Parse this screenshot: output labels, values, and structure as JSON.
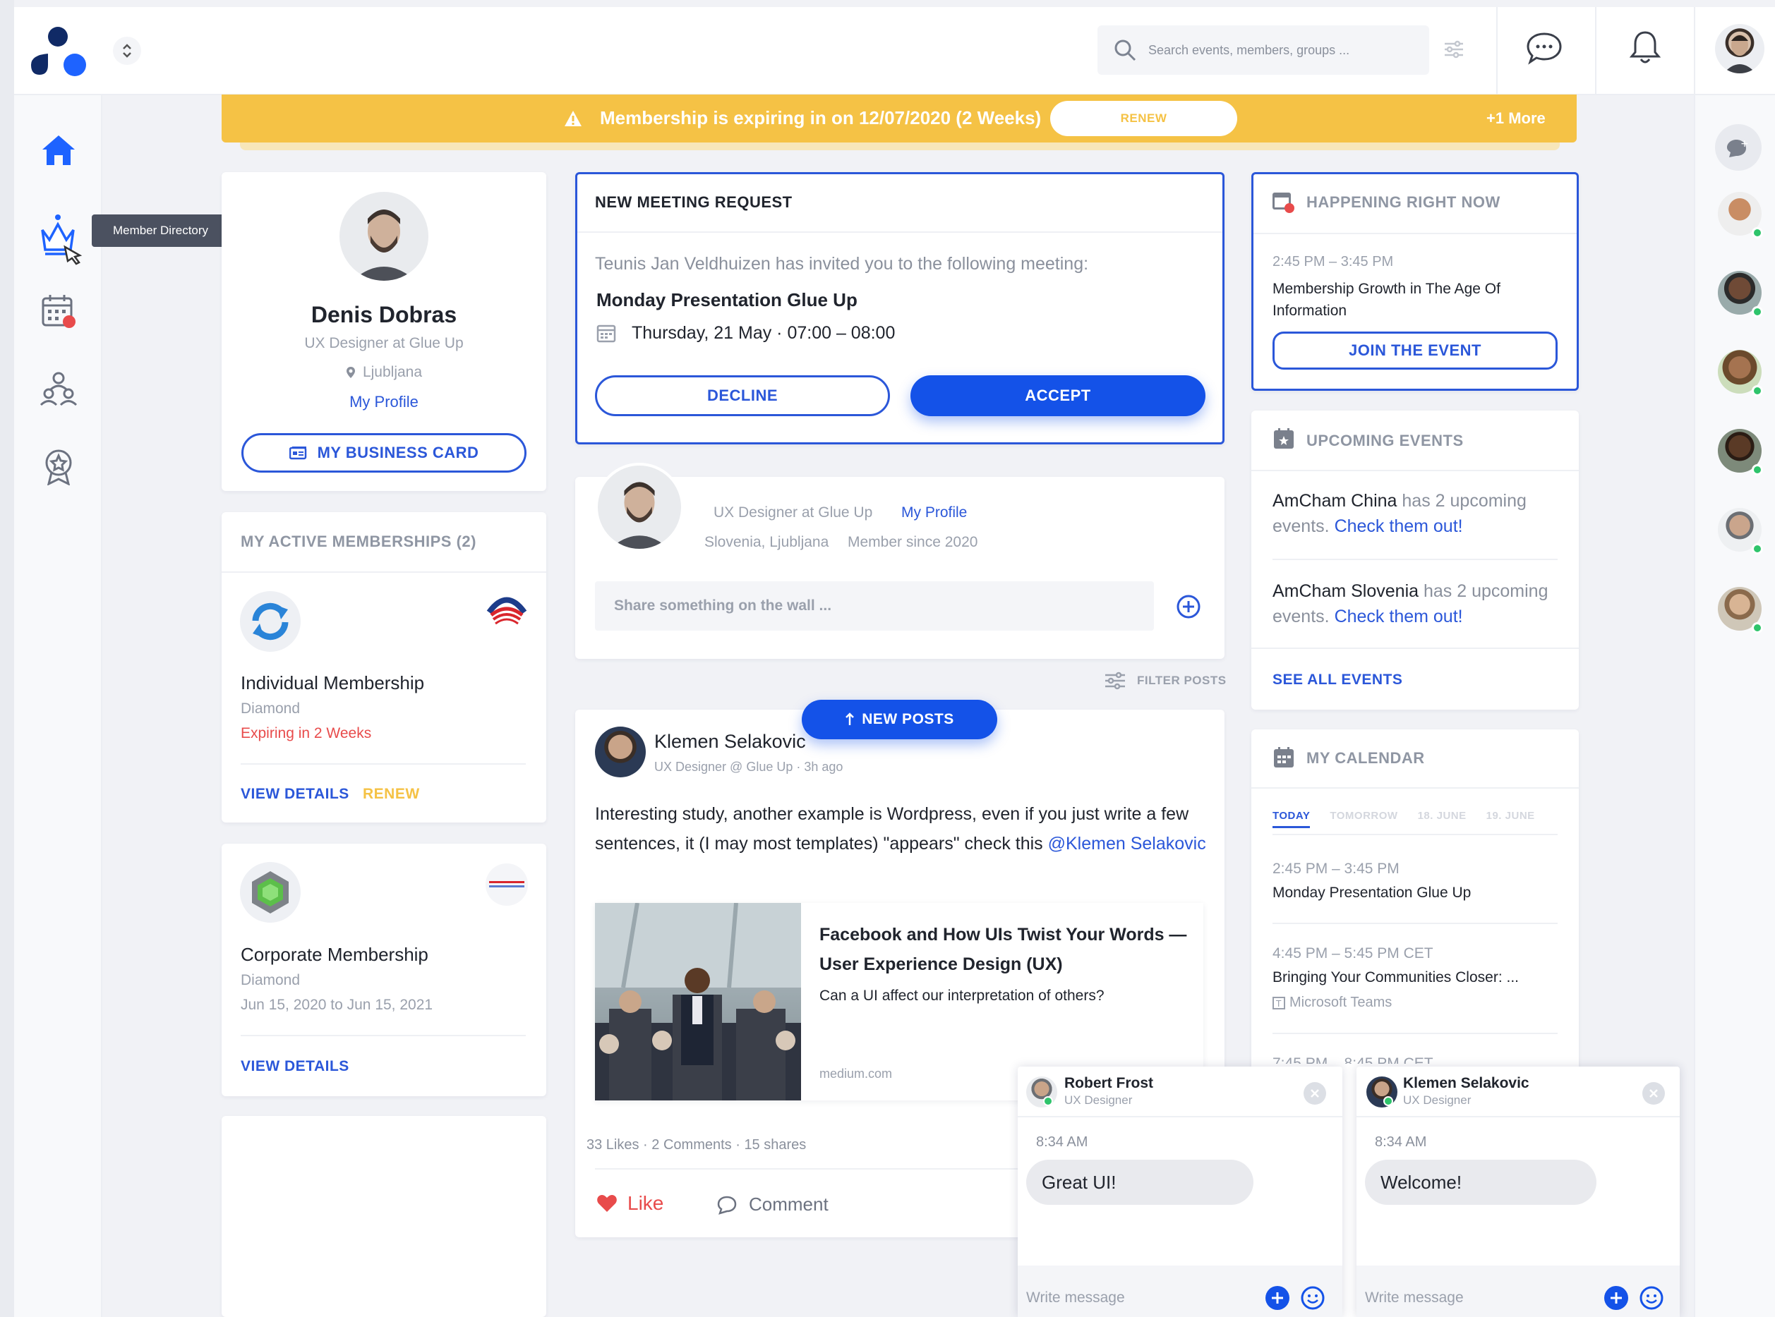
{
  "header": {
    "search_placeholder": "Search events, members, groups ..."
  },
  "sidebar": {
    "tooltip": "Member Directory"
  },
  "banner": {
    "message": "Membership is expiring in on 12/07/2020 (2 Weeks)",
    "renew_label": "RENEW",
    "more_label": "+1 More"
  },
  "profile": {
    "name": "Denis Dobras",
    "role": "UX Designer at Glue Up",
    "location": "Ljubljana",
    "profile_link": "My Profile",
    "business_card_label": "MY BUSINESS CARD"
  },
  "memberships": {
    "title": "MY ACTIVE MEMBERSHIPS (2)",
    "items": [
      {
        "name": "Individual Membership",
        "tier": "Diamond",
        "status": "Expiring in 2 Weeks",
        "view_label": "VIEW DETAILS",
        "renew_label": "RENEW"
      },
      {
        "name": "Corporate Membership",
        "tier": "Diamond",
        "status": "Jun 15, 2020 to Jun 15, 2021",
        "view_label": "VIEW DETAILS"
      }
    ]
  },
  "meeting": {
    "title": "NEW MEETING REQUEST",
    "invite_text": "Teunis Jan Veldhuizen has invited you to the following meeting:",
    "meeting_name": "Monday Presentation Glue Up",
    "meeting_time": "Thursday, 21 May · 07:00 – 08:00",
    "decline_label": "DECLINE",
    "accept_label": "ACCEPT"
  },
  "composer": {
    "role": "UX Designer at Glue Up",
    "profile_link": "My Profile",
    "location": "Slovenia, Ljubljana",
    "member_since": "Member since 2020",
    "placeholder": "Share something on the wall ...",
    "filter_label": "FILTER POSTS",
    "new_posts_label": "NEW POSTS"
  },
  "post": {
    "author": "Klemen Selakovic",
    "meta": "UX Designer @ Glue Up · 3h ago",
    "text": "Interesting study, another example is Wordpress, even if you just write a few sentences, it (I may most templates) \"appears\" check this",
    "mention": "@Klemen Selakovic",
    "link_title": "Facebook and How UIs Twist Your Words — User Experience Design (UX)",
    "link_desc": "Can a UI affect our interpretation of others?",
    "link_source": "medium.com",
    "likes": "33 Likes",
    "comments": "2 Comments",
    "shares": "15 shares",
    "like_label": "Like",
    "comment_label": "Comment"
  },
  "happening": {
    "title": "HAPPENING RIGHT NOW",
    "time": "2:45 PM – 3:45 PM",
    "event": "Membership Growth in The Age Of Information",
    "join_label": "JOIN THE EVENT"
  },
  "upcoming": {
    "title": "UPCOMING EVENTS",
    "items": [
      {
        "org": "AmCham China",
        "text": "has 2 upcoming events.",
        "link": "Check them out!"
      },
      {
        "org": "AmCham Slovenia",
        "text": "has 2 upcoming events.",
        "link": "Check them out!"
      }
    ],
    "see_all": "SEE ALL EVENTS"
  },
  "calendar": {
    "title": "MY CALENDAR",
    "tabs": [
      "TODAY",
      "TOMORROW",
      "18. JUNE",
      "19. JUNE"
    ],
    "events": [
      {
        "time": "2:45 PM – 3:45 PM",
        "name": "Monday Presentation Glue Up"
      },
      {
        "time": "4:45 PM – 5:45 PM CET",
        "name": "Bringing Your Communities Closer: ...",
        "location": "Microsoft Teams"
      },
      {
        "time": "7:45 PM – 8:45 PM CET"
      }
    ]
  },
  "chats": [
    {
      "name": "Robert Frost",
      "role": "UX Designer",
      "time": "8:34 AM",
      "message": "Great UI!",
      "placeholder": "Write message"
    },
    {
      "name": "Klemen Selakovic",
      "role": "UX Designer",
      "time": "8:34 AM",
      "message": "Welcome!",
      "placeholder": "Write message"
    }
  ],
  "colors": {
    "accent": "#1452e8",
    "banner": "#f5c245",
    "danger": "#e84b4b"
  }
}
